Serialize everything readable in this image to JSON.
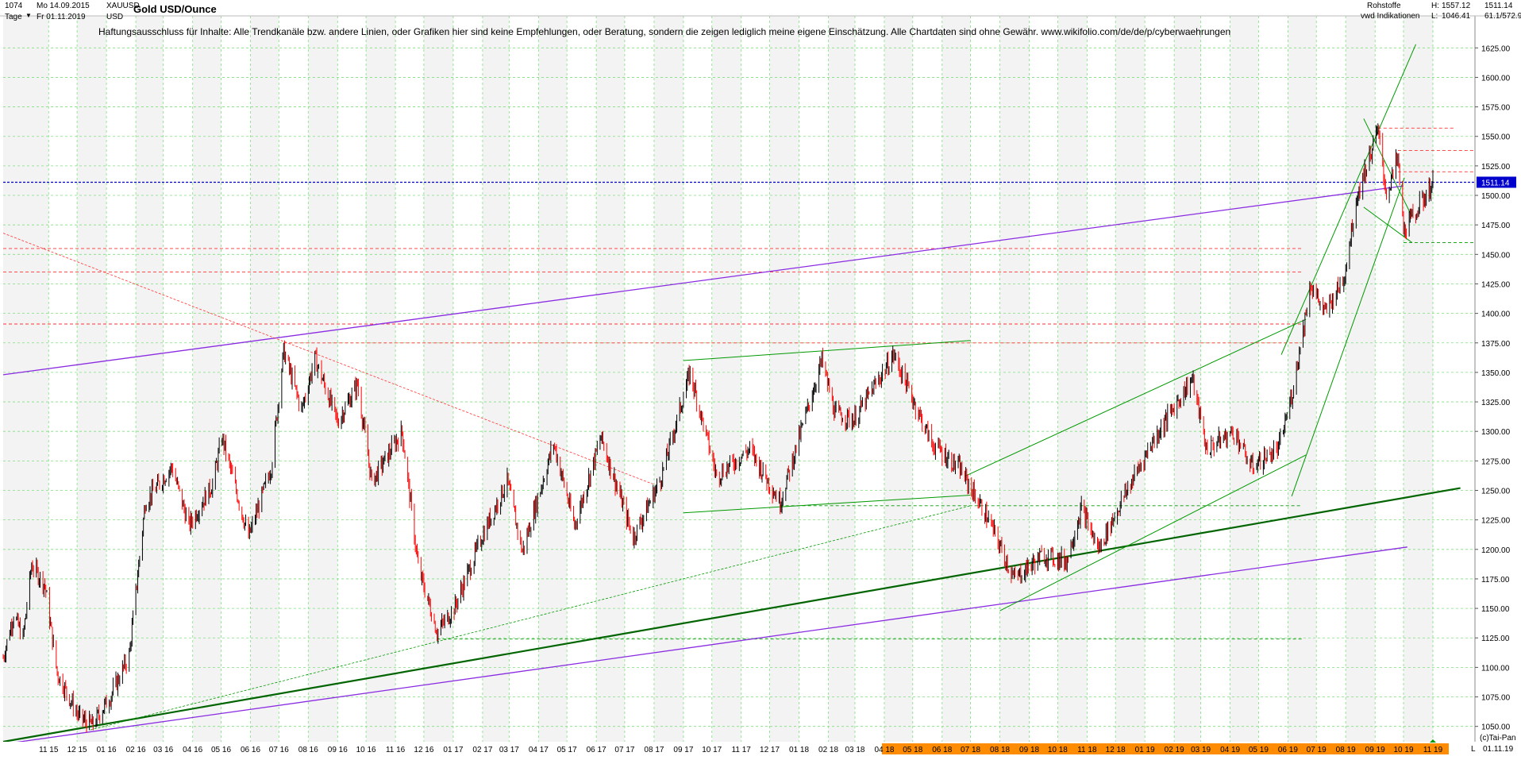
{
  "header": {
    "count": "1074",
    "start_label": "Mo 14.09.2015",
    "symbol": "XAUUSD",
    "timeframe": "Tage",
    "end_label": "Fr 01.11.2019",
    "currency": "USD",
    "title": "Gold USD/Ounce",
    "disclaimer": "Haftungsausschluss für Inhalte: Alle Trendkanäle bzw. andere Linien, oder Grafiken hier sind keine Empfehlungen, oder Beratung, sondern die zeigen lediglich meine eigene Einschätzung. Alle Chartdaten sind ohne Gewähr.  www.wikifolio.com/de/de/p/cyberwaehrungen",
    "category": "Rohstoffe",
    "source": "vwd Indikationen",
    "high_label": "H:",
    "high_value": "1557.12",
    "low_label": "L:",
    "low_value": "1046.41",
    "last_value": "1511.14",
    "change_value": "61.1/572.9"
  },
  "footer": {
    "corner_letter": "L",
    "end_date": "01.11.19",
    "copyright": "(c)Tai-Pan"
  },
  "colors": {
    "background": "#ffffff",
    "plot_shade": "#f3f3f3",
    "grid": "#7fe07f",
    "up_candle": "#000000",
    "down_candle": "#ff0000",
    "trend_green": "#009900",
    "trend_dark_green": "#006400",
    "channel_purple": "#8a2be2",
    "resistance_red": "#ff3333",
    "last_price_blue": "#0000cc",
    "date_highlight": "#ff8c00"
  },
  "chart_data": {
    "type": "candlestick",
    "title": "Gold USD/Ounce",
    "symbol": "XAUUSD",
    "unit": "USD",
    "ylim": [
      1037,
      1640
    ],
    "y_ticks": [
      1050,
      1075,
      1100,
      1125,
      1150,
      1175,
      1200,
      1225,
      1250,
      1275,
      1300,
      1325,
      1350,
      1375,
      1400,
      1425,
      1450,
      1475,
      1500,
      1525,
      1550,
      1575,
      1600,
      1625
    ],
    "x_labels": [
      "11 15",
      "12 15",
      "01 16",
      "02 16",
      "03 16",
      "04 16",
      "05 16",
      "06 16",
      "07 16",
      "08 16",
      "09 16",
      "10 16",
      "11 16",
      "12 16",
      "01 17",
      "02 17",
      "03 17",
      "04 17",
      "05 17",
      "06 17",
      "07 17",
      "08 17",
      "09 17",
      "10 17",
      "11 17",
      "12 17",
      "01 18",
      "02 18",
      "03 18",
      "04 18",
      "05 18",
      "06 18",
      "07 18",
      "08 18",
      "09 18",
      "10 18",
      "11 18",
      "12 18",
      "01 19",
      "02 19",
      "03 19",
      "04 19",
      "05 19",
      "06 19",
      "07 19",
      "08 19",
      "09 19",
      "10 19",
      "11 19"
    ],
    "highlighted_x_labels_from": "04 18",
    "grid": true,
    "last_price": 1511.14,
    "high": 1557.12,
    "low": 1046.41,
    "price_path": [
      [
        "2015-09-14",
        1108
      ],
      [
        "2015-09-25",
        1145
      ],
      [
        "2015-10-05",
        1125
      ],
      [
        "2015-10-14",
        1187
      ],
      [
        "2015-10-28",
        1170
      ],
      [
        "2015-11-10",
        1095
      ],
      [
        "2015-12-03",
        1058
      ],
      [
        "2015-12-17",
        1051
      ],
      [
        "2016-01-05",
        1075
      ],
      [
        "2016-01-25",
        1110
      ],
      [
        "2016-02-11",
        1240
      ],
      [
        "2016-03-10",
        1270
      ],
      [
        "2016-03-28",
        1220
      ],
      [
        "2016-04-22",
        1255
      ],
      [
        "2016-05-02",
        1295
      ],
      [
        "2016-05-30",
        1210
      ],
      [
        "2016-06-23",
        1270
      ],
      [
        "2016-07-06",
        1368
      ],
      [
        "2016-07-25",
        1318
      ],
      [
        "2016-08-08",
        1362
      ],
      [
        "2016-09-01",
        1308
      ],
      [
        "2016-09-22",
        1340
      ],
      [
        "2016-10-07",
        1257
      ],
      [
        "2016-11-08",
        1300
      ],
      [
        "2016-11-25",
        1185
      ],
      [
        "2016-12-15",
        1130
      ],
      [
        "2017-01-02",
        1150
      ],
      [
        "2017-01-31",
        1210
      ],
      [
        "2017-02-27",
        1258
      ],
      [
        "2017-03-15",
        1198
      ],
      [
        "2017-04-17",
        1290
      ],
      [
        "2017-05-09",
        1220
      ],
      [
        "2017-06-06",
        1295
      ],
      [
        "2017-07-10",
        1210
      ],
      [
        "2017-08-08",
        1260
      ],
      [
        "2017-09-08",
        1350
      ],
      [
        "2017-10-06",
        1262
      ],
      [
        "2017-11-10",
        1285
      ],
      [
        "2017-12-12",
        1240
      ],
      [
        "2018-01-25",
        1360
      ],
      [
        "2018-02-08",
        1315
      ],
      [
        "2018-02-28",
        1310
      ],
      [
        "2018-04-11",
        1365
      ],
      [
        "2018-05-21",
        1290
      ],
      [
        "2018-06-20",
        1268
      ],
      [
        "2018-07-20",
        1225
      ],
      [
        "2018-08-16",
        1175
      ],
      [
        "2018-09-15",
        1195
      ],
      [
        "2018-10-10",
        1190
      ],
      [
        "2018-10-26",
        1235
      ],
      [
        "2018-11-13",
        1200
      ],
      [
        "2018-12-10",
        1245
      ],
      [
        "2019-01-08",
        1290
      ],
      [
        "2019-02-20",
        1345
      ],
      [
        "2019-03-07",
        1285
      ],
      [
        "2019-04-05",
        1300
      ],
      [
        "2019-04-23",
        1270
      ],
      [
        "2019-05-22",
        1285
      ],
      [
        "2019-06-05",
        1330
      ],
      [
        "2019-06-25",
        1425
      ],
      [
        "2019-07-10",
        1400
      ],
      [
        "2019-07-30",
        1430
      ],
      [
        "2019-08-13",
        1500
      ],
      [
        "2019-09-04",
        1555
      ],
      [
        "2019-09-13",
        1500
      ],
      [
        "2019-09-25",
        1532
      ],
      [
        "2019-10-01",
        1470
      ],
      [
        "2019-10-21",
        1495
      ],
      [
        "2019-11-01",
        1511
      ]
    ],
    "trend_lines": [
      {
        "name": "purple-upper-channel",
        "color": "purple",
        "points": [
          [
            "2015-09-14",
            1348
          ],
          [
            "2019-10-01",
            1508
          ]
        ]
      },
      {
        "name": "purple-lower-channel",
        "color": "purple",
        "points": [
          [
            "2015-09-14",
            1035
          ],
          [
            "2019-10-05",
            1202
          ]
        ]
      },
      {
        "name": "dark-green-support",
        "color": "dark-green",
        "points": [
          [
            "2015-09-14",
            1037
          ],
          [
            "2019-11-30",
            1252
          ]
        ]
      },
      {
        "name": "green-range-top-2017",
        "color": "green",
        "points": [
          [
            "2017-09-01",
            1360
          ],
          [
            "2018-07-01",
            1377
          ]
        ]
      },
      {
        "name": "green-range-bottom-2017",
        "color": "green",
        "points": [
          [
            "2017-09-01",
            1231
          ],
          [
            "2018-07-01",
            1246
          ]
        ]
      },
      {
        "name": "green-channel-2018-upper",
        "color": "green",
        "points": [
          [
            "2018-06-25",
            1262
          ],
          [
            "2019-06-20",
            1395
          ]
        ]
      },
      {
        "name": "green-channel-2018-lower",
        "color": "green",
        "points": [
          [
            "2018-08-01",
            1148
          ],
          [
            "2019-06-20",
            1280
          ]
        ]
      },
      {
        "name": "green-steep-up-1",
        "color": "green",
        "points": [
          [
            "2019-05-25",
            1365
          ],
          [
            "2019-10-14",
            1628
          ]
        ]
      },
      {
        "name": "green-steep-up-2",
        "color": "green",
        "points": [
          [
            "2019-06-05",
            1245
          ],
          [
            "2019-10-02",
            1515
          ]
        ]
      },
      {
        "name": "green-triangle-upper",
        "color": "green",
        "points": [
          [
            "2019-08-20",
            1565
          ],
          [
            "2019-10-10",
            1482
          ]
        ]
      },
      {
        "name": "green-triangle-lower",
        "color": "green",
        "points": [
          [
            "2019-08-20",
            1490
          ],
          [
            "2019-10-10",
            1460
          ]
        ]
      },
      {
        "name": "green-dashed-support",
        "color": "green-dashed",
        "points": [
          [
            "2015-12-15",
            1047
          ],
          [
            "2018-07-01",
            1237
          ]
        ]
      },
      {
        "name": "red-dashed-downtrend",
        "color": "red-dashed",
        "points": [
          [
            "2015-09-14",
            1468
          ],
          [
            "2017-08-01",
            1255
          ]
        ]
      }
    ],
    "horizontal_levels": [
      {
        "name": "last-price",
        "value": 1511.14,
        "color": "blue-dashed",
        "from": "2015-09-14"
      },
      {
        "name": "level-1557",
        "value": 1557,
        "color": "red-dashed",
        "from": "2019-09-04"
      },
      {
        "name": "level-1538",
        "value": 1538,
        "color": "red-dashed",
        "from": "2019-09-25"
      },
      {
        "name": "level-1520",
        "value": 1520,
        "color": "red-dashed",
        "from": "2019-09-25"
      },
      {
        "name": "level-1460",
        "value": 1460,
        "color": "green-dashed",
        "from": "2019-10-01"
      },
      {
        "name": "level-1455",
        "value": 1455,
        "color": "red-dashed",
        "from": "2015-09-14"
      },
      {
        "name": "level-1435",
        "value": 1435,
        "color": "red-dashed",
        "from": "2015-09-14"
      },
      {
        "name": "level-1391",
        "value": 1391,
        "color": "red-dashed",
        "from": "2015-09-14"
      },
      {
        "name": "level-1375",
        "value": 1375,
        "color": "red-dashed",
        "from": "2016-07-06"
      },
      {
        "name": "level-1237",
        "value": 1237,
        "color": "green-dashed",
        "from": "2017-12-12"
      },
      {
        "name": "level-1124",
        "value": 1124,
        "color": "green-dashed",
        "from": "2016-12-15"
      }
    ]
  }
}
